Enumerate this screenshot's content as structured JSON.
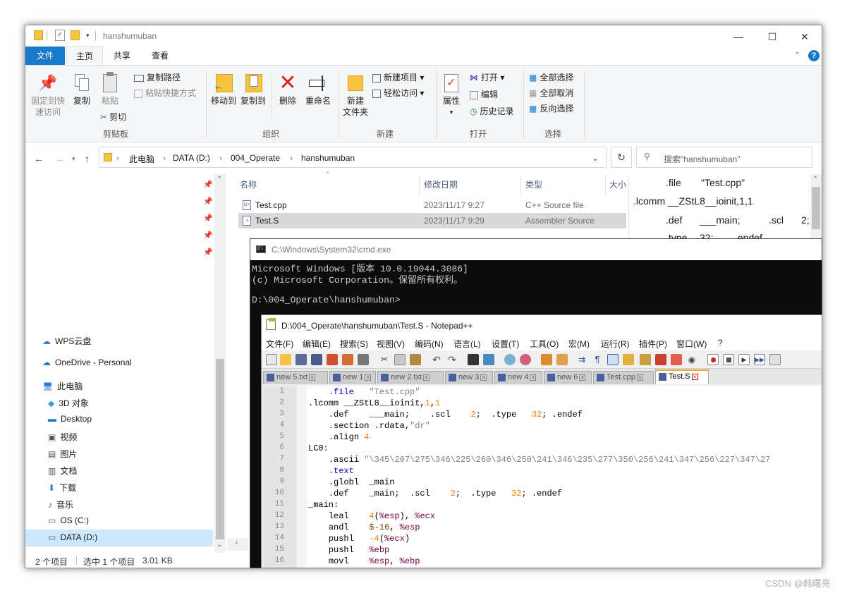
{
  "explorer": {
    "title": "hanshumuban",
    "tabs": {
      "file": "文件",
      "home": "主页",
      "share": "共享",
      "view": "查看"
    },
    "ribbon": {
      "pin_quick": [
        "固定到快",
        "速访问"
      ],
      "copy": "复制",
      "paste": "粘贴",
      "copy_path": "复制路径",
      "paste_shortcut": "粘贴快捷方式",
      "cut": "剪切",
      "clipboard_group": "剪贴板",
      "move_to": "移动到",
      "copy_to": "复制到",
      "delete": "删除",
      "rename": "重命名",
      "organize_group": "组织",
      "new_folder": [
        "新建",
        "文件夹"
      ],
      "new_item": "新建项目",
      "easy_access": "轻松访问",
      "new_group": "新建",
      "properties": "属性",
      "open": "打开",
      "edit": "编辑",
      "history": "历史记录",
      "open_group": "打开",
      "select_all": "全部选择",
      "select_none": "全部取消",
      "invert_select": "反向选择",
      "select_group": "选择"
    },
    "address": [
      "此电脑",
      "DATA (D:)",
      "004_Operate",
      "hanshumuban"
    ],
    "search_placeholder": "搜索\"hanshumuban\"",
    "nav": {
      "wps": "WPS云盘",
      "onedrive": "OneDrive - Personal",
      "this_pc": "此电脑",
      "objects3d": "3D 对象",
      "desktop": "Desktop",
      "videos": "视频",
      "pictures": "图片",
      "documents": "文档",
      "downloads": "下载",
      "music": "音乐",
      "os_c": "OS (C:)",
      "data_d": "DATA (D:)"
    },
    "columns": {
      "name": "名称",
      "date": "修改日期",
      "type": "类型",
      "size": "大小"
    },
    "files": [
      {
        "name": "Test.cpp",
        "date": "2023/11/17 9:27",
        "type": "C++ Source file"
      },
      {
        "name": "Test.S",
        "date": "2023/11/17 9:29",
        "type": "Assembler Source"
      }
    ],
    "preview": [
      ".file",
      "\"Test.cpp\"",
      ".lcomm __ZStL8__ioinit,1,1",
      ".def",
      "___main;",
      ".scl",
      "2;",
      ".type",
      "32;",
      ".endef"
    ],
    "status": {
      "count": "2 个项目",
      "selected": "选中 1 个项目",
      "size": "3.01 KB"
    }
  },
  "cmd": {
    "title": "C:\\Windows\\System32\\cmd.exe",
    "lines": [
      "Microsoft Windows [版本 10.0.19044.3086]",
      "(c) Microsoft Corporation。保留所有权利。",
      "",
      "D:\\004_Operate\\hanshumuban>"
    ]
  },
  "npp": {
    "title": "D:\\004_Operate\\hanshumuban\\Test.S - Notepad++",
    "menu": [
      "文件(F)",
      "编辑(E)",
      "搜索(S)",
      "视图(V)",
      "编码(N)",
      "语言(L)",
      "设置(T)",
      "工具(O)",
      "宏(M)",
      "运行(R)",
      "插件(P)",
      "窗口(W)",
      "?"
    ],
    "tabs": [
      "new 5.txt",
      "new 1",
      "new 2.txt",
      "new 3",
      "new 4",
      "new 6",
      "Test.cpp",
      "Test.S"
    ],
    "line_numbers": [
      "1",
      "2",
      "3",
      "4",
      "5",
      "6",
      "7",
      "8",
      "9",
      "10",
      "11",
      "12",
      "13",
      "14",
      "15",
      "16"
    ],
    "code": [
      {
        "indent": "    ",
        "parts": [
          [
            ".file",
            "dir"
          ],
          [
            "   ",
            ""
          ],
          [
            "\"Test.cpp\"",
            "str"
          ]
        ]
      },
      {
        "indent": "",
        "parts": [
          [
            ".lcomm __ZStL8__ioinit,",
            ""
          ],
          [
            "1",
            "num"
          ],
          [
            ",",
            ""
          ],
          [
            "1",
            "num"
          ]
        ]
      },
      {
        "indent": "    ",
        "parts": [
          [
            ".def    ___main;    .scl    ",
            ""
          ],
          [
            "2",
            "num"
          ],
          [
            ";  .type   ",
            ""
          ],
          [
            "32",
            "num"
          ],
          [
            "; .endef",
            ""
          ]
        ]
      },
      {
        "indent": "    ",
        "parts": [
          [
            ".section .rdata,",
            ""
          ],
          [
            "\"dr\"",
            "str"
          ]
        ]
      },
      {
        "indent": "    ",
        "parts": [
          [
            ".align ",
            ""
          ],
          [
            "4",
            "num"
          ]
        ]
      },
      {
        "indent": "",
        "parts": [
          [
            "LC0:",
            ""
          ]
        ]
      },
      {
        "indent": "    ",
        "parts": [
          [
            ".ascii ",
            ""
          ],
          [
            "\"\\345\\207\\275\\346\\225\\260\\346\\250\\241\\346\\235\\277\\350\\256\\241\\347\\256\\227\\347\\27",
            "str"
          ]
        ]
      },
      {
        "indent": "    ",
        "parts": [
          [
            ".text",
            "dir"
          ]
        ]
      },
      {
        "indent": "    ",
        "parts": [
          [
            ".globl  _main",
            ""
          ]
        ]
      },
      {
        "indent": "    ",
        "parts": [
          [
            ".def    _main;  .scl    ",
            ""
          ],
          [
            "2",
            "num"
          ],
          [
            ";  .type   ",
            ""
          ],
          [
            "32",
            "num"
          ],
          [
            "; .endef",
            ""
          ]
        ]
      },
      {
        "indent": "",
        "parts": [
          [
            "_main:",
            ""
          ]
        ]
      },
      {
        "indent": "    ",
        "parts": [
          [
            "leal    ",
            ""
          ],
          [
            "4",
            "num"
          ],
          [
            "(",
            ""
          ],
          [
            "%esp",
            "reg"
          ],
          [
            "), ",
            ""
          ],
          [
            "%ecx",
            "reg"
          ]
        ]
      },
      {
        "indent": "    ",
        "parts": [
          [
            "andl    ",
            ""
          ],
          [
            "$-16",
            "sym"
          ],
          [
            ", ",
            ""
          ],
          [
            "%esp",
            "reg"
          ]
        ]
      },
      {
        "indent": "    ",
        "parts": [
          [
            "pushl   ",
            ""
          ],
          [
            "-4",
            "num"
          ],
          [
            "(",
            ""
          ],
          [
            "%ecx",
            "reg"
          ],
          [
            ")",
            ""
          ]
        ]
      },
      {
        "indent": "    ",
        "parts": [
          [
            "pushl   ",
            ""
          ],
          [
            "%ebp",
            "reg"
          ]
        ]
      },
      {
        "indent": "    ",
        "parts": [
          [
            "movl    ",
            ""
          ],
          [
            "%esp",
            "reg"
          ],
          [
            ", ",
            ""
          ],
          [
            "%ebp",
            "reg"
          ]
        ]
      }
    ]
  },
  "watermark": "CSDN @韩曙亮"
}
